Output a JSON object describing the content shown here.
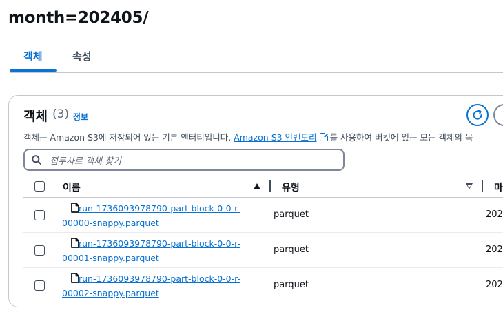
{
  "page": {
    "title": "month=202405/"
  },
  "tabs": [
    {
      "label": "객체"
    },
    {
      "label": "속성"
    }
  ],
  "panel": {
    "heading": "객체",
    "count": "(3)",
    "info_link": "정보",
    "description_pre": "객체는 Amazon S3에 저장되어 있는 기본 엔터티입니다. ",
    "description_link": "Amazon S3 인벤토리",
    "description_post": "를 사용하여 버킷에 있는 모든 객체의 목",
    "search_placeholder": "접두사로 객체 찾기"
  },
  "table": {
    "columns": [
      {
        "label": "이름"
      },
      {
        "label": "유형"
      },
      {
        "label": "마지"
      }
    ],
    "rows": [
      {
        "name": "run-1736093978790-part-block-0-0-r-00000-snappy.parquet",
        "type": "parquet",
        "modified": "202"
      },
      {
        "name": "run-1736093978790-part-block-0-0-r-00001-snappy.parquet",
        "type": "parquet",
        "modified": "202"
      },
      {
        "name": "run-1736093978790-part-block-0-0-r-00002-snappy.parquet",
        "type": "parquet",
        "modified": "202"
      }
    ]
  },
  "icons": {
    "refresh": "refresh-icon",
    "search": "search-icon",
    "file": "file-icon",
    "external": "external-link-icon"
  },
  "colors": {
    "accent": "#0972d3",
    "text": "#0f141a",
    "muted": "#5f6b7a",
    "border": "#c6c6cd"
  }
}
